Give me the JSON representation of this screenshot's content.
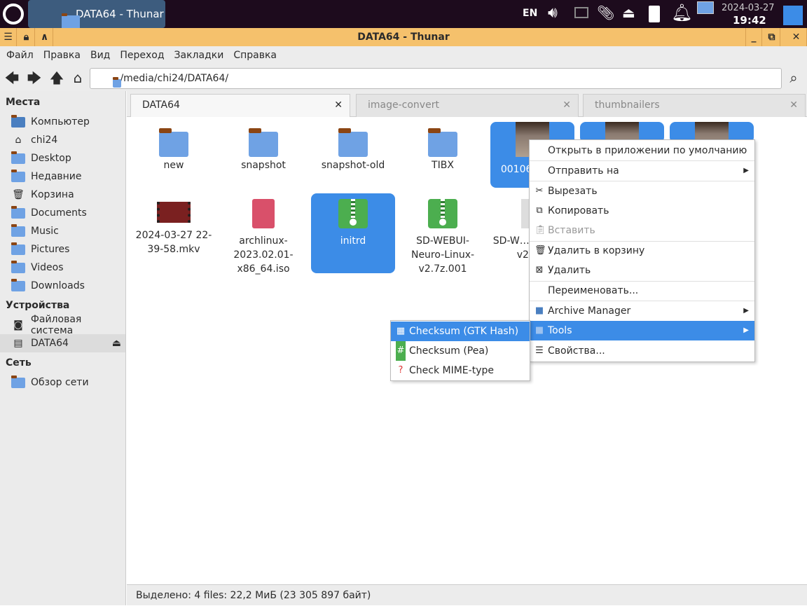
{
  "taskbar": {
    "task": "DATA64 - Thunar",
    "lang": "EN",
    "date": "2024-03-27",
    "time": "19:42"
  },
  "window": {
    "title": "DATA64 - Thunar"
  },
  "menubar": [
    "Файл",
    "Правка",
    "Вид",
    "Переход",
    "Закладки",
    "Справка"
  ],
  "address": "/media/chi24/DATA64/",
  "sidebar": {
    "places_header": "Места",
    "places": [
      "Компьютер",
      "chi24",
      "Desktop",
      "Недавние",
      "Корзина",
      "Documents",
      "Music",
      "Pictures",
      "Videos",
      "Downloads"
    ],
    "devices_header": "Устройства",
    "devices": [
      "Файловая система",
      "DATA64"
    ],
    "network_header": "Сеть",
    "network": [
      "Обзор сети"
    ]
  },
  "tabs": [
    {
      "label": "DATA64",
      "active": true
    },
    {
      "label": "image-convert"
    },
    {
      "label": "thumbnailers"
    }
  ],
  "files": [
    {
      "name": "new",
      "type": "folder"
    },
    {
      "name": "snapshot",
      "type": "folder"
    },
    {
      "name": "snapshot-old",
      "type": "folder"
    },
    {
      "name": "TIBX",
      "type": "folder"
    },
    {
      "name": "00106-9… 9.",
      "type": "image",
      "selected": true
    },
    {
      "name": "",
      "type": "image",
      "selected": true
    },
    {
      "name": "",
      "type": "image",
      "selected": true
    },
    {
      "name": "2024-03-27 22-39-58.mkv",
      "type": "video"
    },
    {
      "name": "archlinux-2023.02.01-x86_64.iso",
      "type": "iso"
    },
    {
      "name": "initrd",
      "type": "zip",
      "selected": true
    },
    {
      "name": "SD-WEBUI-Neuro-Linux-v2.7z.001",
      "type": "zip"
    },
    {
      "name": "SD-W… Neuro… v2.7…",
      "type": "text"
    }
  ],
  "context_menu": [
    {
      "label": "Открыть в приложении по умолчанию"
    },
    {
      "label": "Отправить на",
      "submenu": true
    },
    {
      "label": "Вырезать",
      "icon": "scissors"
    },
    {
      "label": "Копировать",
      "icon": "copy"
    },
    {
      "label": "Вставить",
      "icon": "paste",
      "disabled": true
    },
    {
      "label": "Удалить в корзину",
      "icon": "trash"
    },
    {
      "label": "Удалить",
      "icon": "delete"
    },
    {
      "label": "Переименовать..."
    },
    {
      "label": "Archive Manager",
      "icon": "folder",
      "submenu": true
    },
    {
      "label": "Tools",
      "icon": "folder",
      "submenu": true,
      "highlighted": true
    },
    {
      "label": "Свойства...",
      "icon": "list"
    }
  ],
  "tools_submenu": [
    {
      "label": "Checksum (GTK Hash)",
      "highlighted": true
    },
    {
      "label": "Checksum (Pea)"
    },
    {
      "label": "Check MIME-type"
    }
  ],
  "status": "Выделено: 4 files: 22,2 МиБ (23 305 897 байт)",
  "colors": {
    "accent": "#3c8ce7",
    "titlebar": "#f5c16c",
    "taskbar": "#1d0b1d"
  }
}
